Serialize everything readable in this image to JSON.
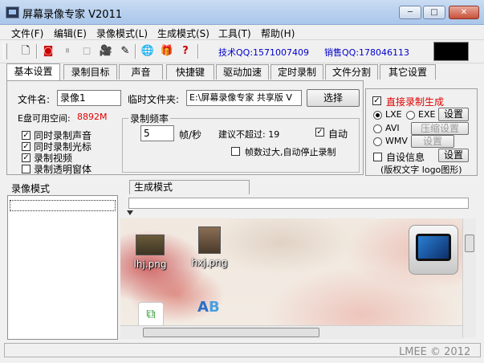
{
  "window": {
    "title": "屏幕录像专家 V2011",
    "min_symbol": "─",
    "max_symbol": "□",
    "close_symbol": "✕"
  },
  "menu": [
    "文件(F)",
    "编辑(E)",
    "录像模式(L)",
    "生成模式(S)",
    "工具(T)",
    "帮助(H)"
  ],
  "toolbar": {
    "tech_qq": "技术QQ:1571007409",
    "sales_qq": "销售QQ:178046113"
  },
  "tabs": [
    "基本设置",
    "录制目标",
    "声音",
    "快捷键",
    "驱动加速",
    "定时录制",
    "文件分割",
    "其它设置"
  ],
  "basic": {
    "filename_label": "文件名:",
    "filename_value": "录像1",
    "tempdir_label": "临时文件夹:",
    "tempdir_value": "E:\\屏幕录像专家 共享版 V",
    "select_button": "选择",
    "disk_label": "E盘可用空间:",
    "disk_value": "8892M",
    "disk_color": "#e00000",
    "checks": [
      {
        "label": "同时录制声音",
        "checked": true
      },
      {
        "label": "同时录制光标",
        "checked": true
      },
      {
        "label": "录制视频",
        "checked": true
      },
      {
        "label": "录制透明窗体",
        "checked": false
      }
    ],
    "freq_group_label": "录制频率",
    "freq_value": "5",
    "freq_unit": "帧/秒",
    "suggest_label": "建议不超过: 19",
    "auto_label": "自动",
    "auto_checked": true,
    "stop_label": "帧数过大,自动停止录制",
    "stop_checked": false
  },
  "output": {
    "direct_label": "直接录制生成",
    "direct_checked": true,
    "direct_color": "#e00000",
    "formats": [
      {
        "label": "LXE",
        "selected": true
      },
      {
        "label": "EXE",
        "selected": false
      },
      {
        "label": "AVI",
        "selected": false
      },
      {
        "label": "WMV",
        "selected": false
      }
    ],
    "settings_button": "设置",
    "compress_button": "压缩设置",
    "settings_button_2": "设置",
    "custom_info_label": "自设信息",
    "custom_info_checked": false,
    "settings_button_3": "设置",
    "copyright_note": "(版权文字 logo图形)"
  },
  "bottom": {
    "record_mode_label": "录像模式",
    "gen_mode_tab": "生成模式",
    "ruler_marker": "▽"
  },
  "desktop_icons": [
    {
      "label": "lhj.png"
    },
    {
      "label": "hxj.png"
    }
  ],
  "watermark": "LMEE © 2012"
}
